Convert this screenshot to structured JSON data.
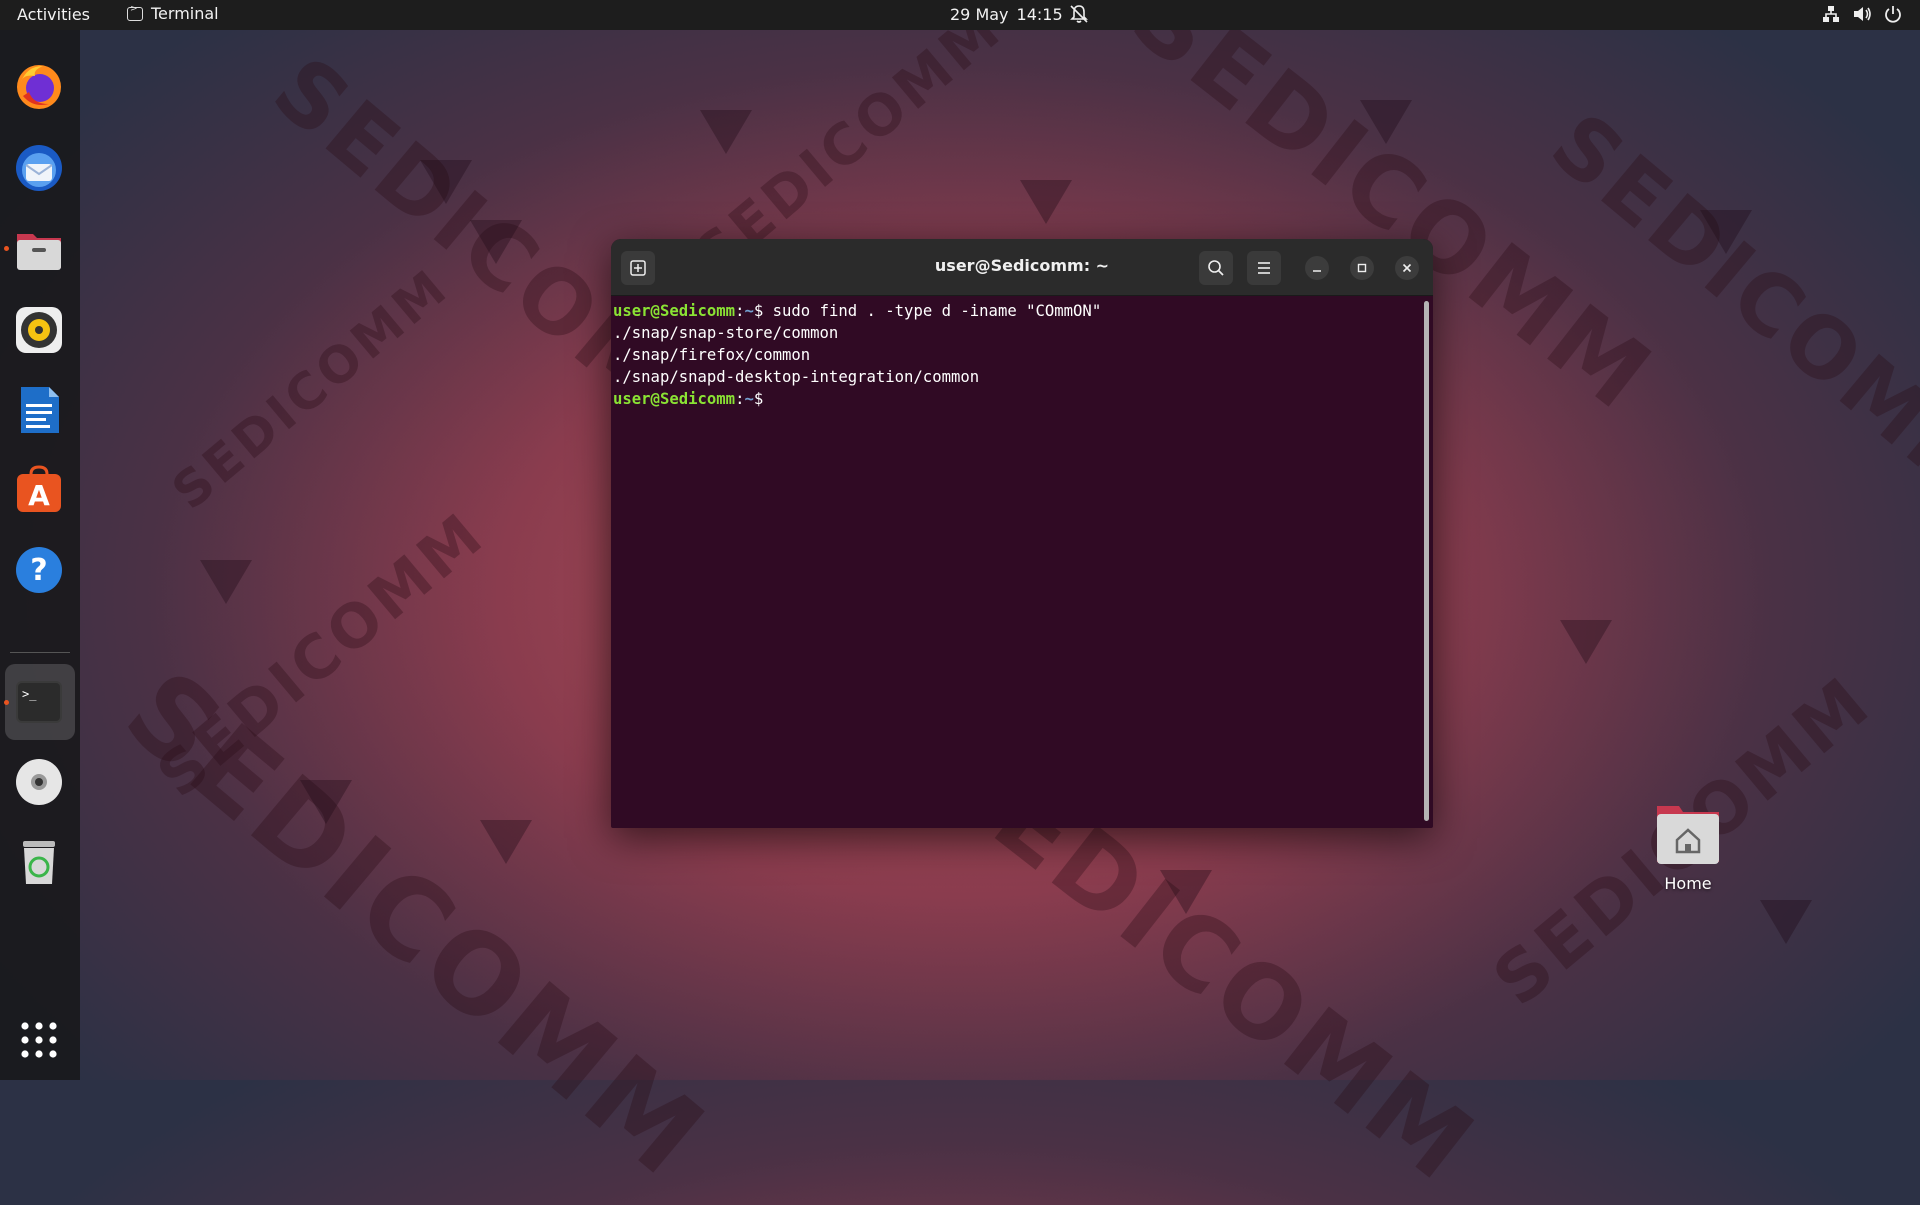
{
  "topbar": {
    "activities": "Activities",
    "app_name": "Terminal",
    "date": "29 May",
    "time": "14:15",
    "icons": [
      "bell-icon",
      "network-icon",
      "volume-icon",
      "power-icon"
    ]
  },
  "dock": {
    "apps": [
      {
        "name": "firefox",
        "icon": "firefox-icon"
      },
      {
        "name": "thunderbird",
        "icon": "thunderbird-icon"
      },
      {
        "name": "files",
        "icon": "files-icon",
        "running": true
      },
      {
        "name": "rhythmbox",
        "icon": "rhythmbox-icon"
      },
      {
        "name": "writer",
        "icon": "libreoffice-writer-icon"
      },
      {
        "name": "software",
        "icon": "app-center-icon"
      },
      {
        "name": "help",
        "icon": "help-icon"
      },
      {
        "name": "terminal",
        "icon": "terminal-icon",
        "running": true,
        "active": true
      },
      {
        "name": "disc",
        "icon": "optical-disc-icon"
      },
      {
        "name": "trash",
        "icon": "trash-icon"
      },
      {
        "name": "app-grid",
        "icon": "show-apps-icon"
      }
    ]
  },
  "terminal": {
    "title": "user@Sedicomm: ~",
    "prompt_user": "user@Sedicomm",
    "prompt_sep": ":",
    "prompt_path": "~",
    "prompt_symbol": "$",
    "command": " sudo find . -type d -iname \"COmmON\"",
    "output": [
      "./snap/snap-store/common",
      "./snap/firefox/common",
      "./snap/snapd-desktop-integration/common"
    ],
    "bg_color": "#300a24"
  },
  "desktop": {
    "home_label": "Home",
    "watermark": "SEDICOMM"
  },
  "colors": {
    "accent": "#e95420",
    "prompt_green": "#8ae234",
    "prompt_blue": "#729fcf"
  }
}
